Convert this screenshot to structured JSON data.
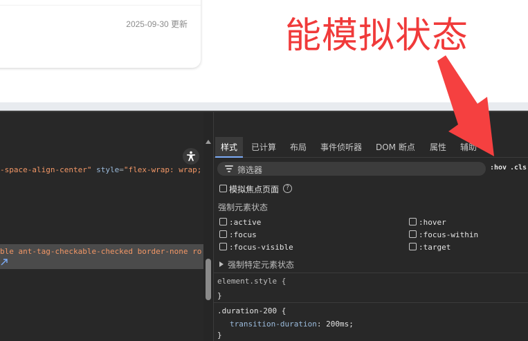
{
  "page": {
    "card_meta": "2025-09-30 更新",
    "annotation": "能模拟状态"
  },
  "elements_panel": {
    "line1": {
      "attr_value_tail": "-space-align-center\"",
      "attr_name": "style",
      "eq": "=",
      "attr_value": "\"flex-wrap: wrap;"
    },
    "selected_line": "ble ant-tag-checkable-checked border-none ro"
  },
  "styles_panel": {
    "tabs": [
      "样式",
      "已计算",
      "布局",
      "事件侦听器",
      "DOM 断点",
      "属性",
      "辅助"
    ],
    "filter_placeholder": "筛选器",
    "hov_label": ":hov",
    "cls_label": ".cls",
    "emulate_focus_label": "模拟焦点页面",
    "help_glyph": "?",
    "force_state_title": "强制元素状态",
    "states_left": [
      ":active",
      ":focus",
      ":focus-visible"
    ],
    "states_right": [
      ":hover",
      ":focus-within",
      ":target"
    ],
    "force_specific_label": "强制特定元素状态",
    "rules": {
      "element_style_selector": "element.style {",
      "close_brace": "}",
      "duration_selector": ".duration-200 {",
      "duration_prop": "transition-duration",
      "duration_colon": ":",
      "duration_value": " 200ms;",
      "duration_close": "}"
    }
  },
  "colors": {
    "annotation_red": "#f03a3a",
    "arrow_red": "#f54040",
    "active_tab_underline": "#7cacf8",
    "devtools_bg": "#282828"
  },
  "icons": [
    "accessibility-icon",
    "filter-icon",
    "help-icon",
    "expand-triangle-icon",
    "scroll-up-icon",
    "annotation-arrow-icon"
  ]
}
